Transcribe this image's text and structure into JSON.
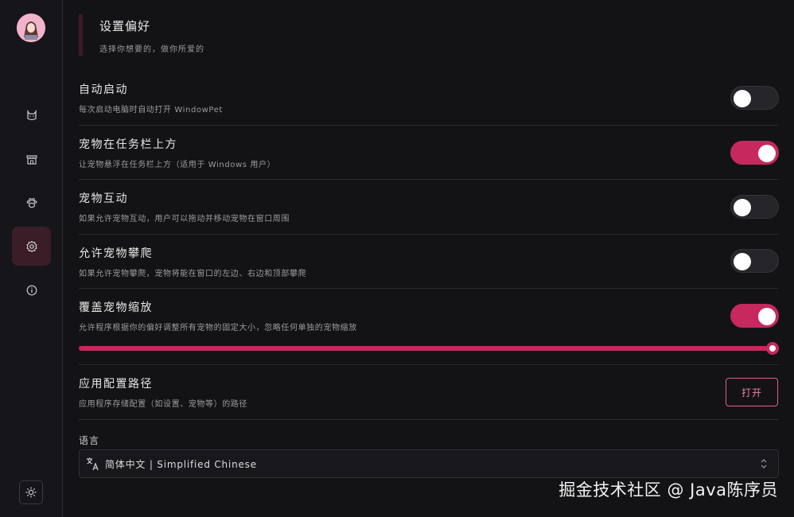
{
  "sidebar": {
    "items": [
      {
        "name": "cat",
        "icon": "cat-icon"
      },
      {
        "name": "store",
        "icon": "store-icon"
      },
      {
        "name": "paw",
        "icon": "paw-icon"
      },
      {
        "name": "settings",
        "icon": "gear-icon",
        "active": true
      },
      {
        "name": "about",
        "icon": "info-icon"
      }
    ],
    "theme_icon": "sun-icon"
  },
  "header": {
    "title": "设置偏好",
    "subtitle": "选择你想要的，做你所爱的"
  },
  "settings": [
    {
      "title": "自动启动",
      "desc": "每次启动电脑时自动打开 WindowPet",
      "enabled": false
    },
    {
      "title": "宠物在任务栏上方",
      "desc": "让宠物悬浮在任务栏上方（适用于 Windows 用户）",
      "enabled": true
    },
    {
      "title": "宠物互动",
      "desc": "如果允许宠物互动，用户可以拖动并移动宠物在窗口周围",
      "enabled": false
    },
    {
      "title": "允许宠物攀爬",
      "desc": "如果允许宠物攀爬，宠物将能在窗口的左边、右边和顶部攀爬",
      "enabled": false
    },
    {
      "title": "覆盖宠物缩放",
      "desc": "允许程序根据你的偏好调整所有宠物的固定大小，忽略任何单独的宠物缩放",
      "enabled": true
    }
  ],
  "scale_slider": {
    "value_fraction": 1.0
  },
  "config_path": {
    "title": "应用配置路径",
    "desc": "应用程序存储配置（如设置、宠物等）的路径",
    "button_label": "打开"
  },
  "language": {
    "label": "语言",
    "selected": "简体中文 | Simplified Chinese",
    "icon": "translate-icon"
  },
  "watermark": "掘金技术社区 @ Java陈序员",
  "colors": {
    "accent": "#c7285e",
    "background": "#131316",
    "active_nav": "#3a1d27"
  }
}
